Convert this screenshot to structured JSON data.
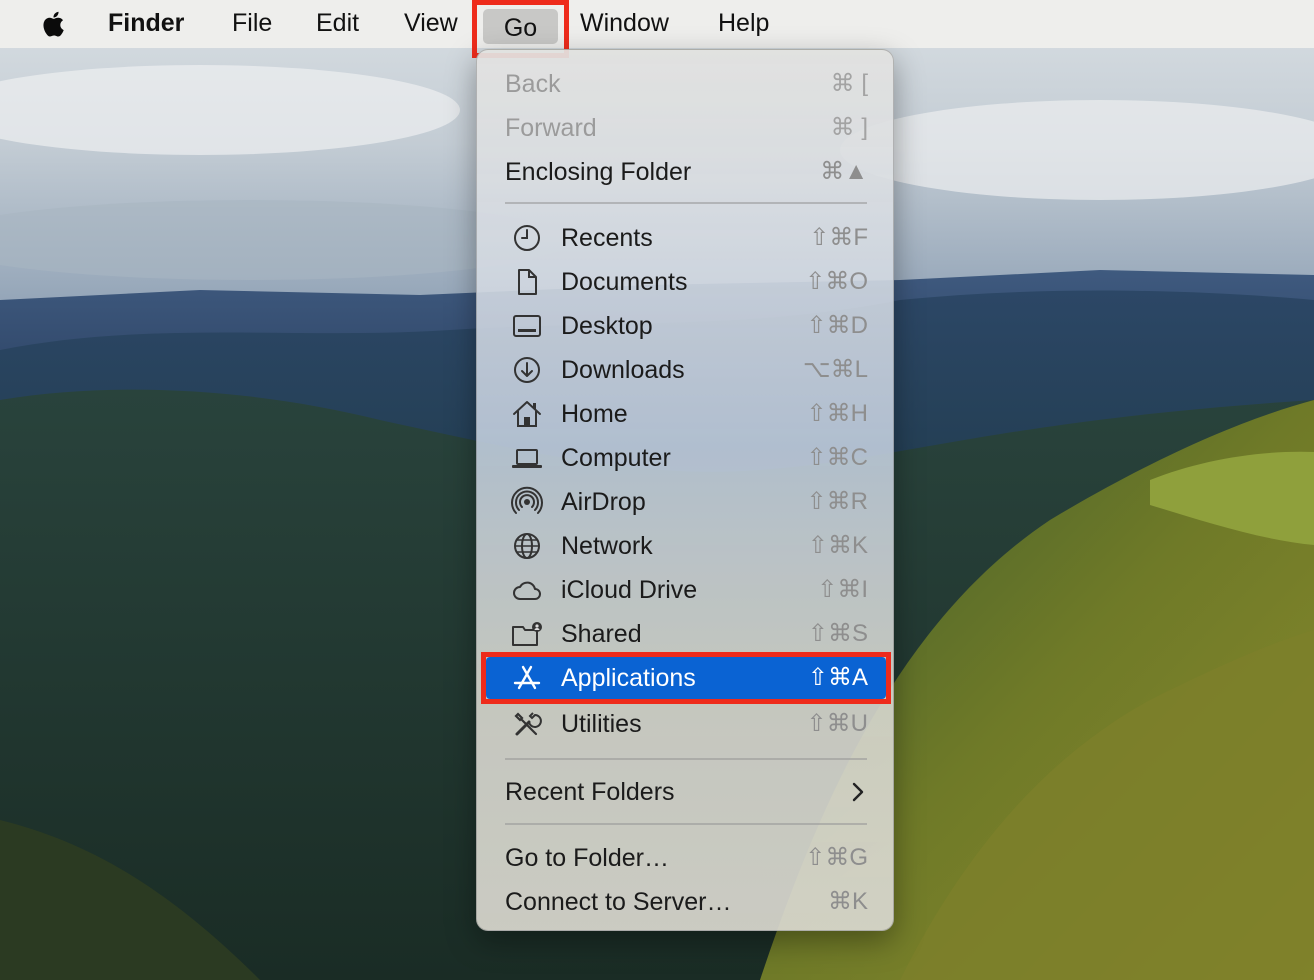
{
  "menubar": {
    "apple_icon": "apple-logo-icon",
    "items": [
      "Finder",
      "File",
      "Edit",
      "View",
      "Go",
      "Window",
      "Help"
    ]
  },
  "go_menu": {
    "group1": [
      {
        "label": "Back",
        "shortcut": "⌘ [",
        "enabled": false
      },
      {
        "label": "Forward",
        "shortcut": "⌘ ]",
        "enabled": false
      },
      {
        "label": "Enclosing Folder",
        "shortcut": "⌘▲",
        "enabled": true
      }
    ],
    "locations": [
      {
        "label": "Recents",
        "shortcut": "⇧⌘F",
        "icon": "clock-icon"
      },
      {
        "label": "Documents",
        "shortcut": "⇧⌘O",
        "icon": "document-icon"
      },
      {
        "label": "Desktop",
        "shortcut": "⇧⌘D",
        "icon": "desktop-icon"
      },
      {
        "label": "Downloads",
        "shortcut": "⌥⌘L",
        "icon": "download-icon"
      },
      {
        "label": "Home",
        "shortcut": "⇧⌘H",
        "icon": "house-icon"
      },
      {
        "label": "Computer",
        "shortcut": "⇧⌘C",
        "icon": "laptop-icon"
      },
      {
        "label": "AirDrop",
        "shortcut": "⇧⌘R",
        "icon": "airdrop-icon"
      },
      {
        "label": "Network",
        "shortcut": "⇧⌘K",
        "icon": "globe-icon"
      },
      {
        "label": "iCloud Drive",
        "shortcut": "⇧⌘I",
        "icon": "cloud-icon"
      },
      {
        "label": "Shared",
        "shortcut": "⇧⌘S",
        "icon": "shared-folder-icon"
      },
      {
        "label": "Applications",
        "shortcut": "⇧⌘A",
        "icon": "applications-icon",
        "selected": true
      },
      {
        "label": "Utilities",
        "shortcut": "⇧⌘U",
        "icon": "utilities-icon"
      }
    ],
    "recent_folders": {
      "label": "Recent Folders",
      "icon": "chevron-right-icon"
    },
    "group_last": [
      {
        "label": "Go to Folder…",
        "shortcut": "⇧⌘G"
      },
      {
        "label": "Connect to Server…",
        "shortcut": "⌘K"
      }
    ]
  },
  "colors": {
    "selection": "#0a63d3",
    "highlight_box": "#ee2b1b",
    "menubar_bg": "#eeeeec"
  }
}
